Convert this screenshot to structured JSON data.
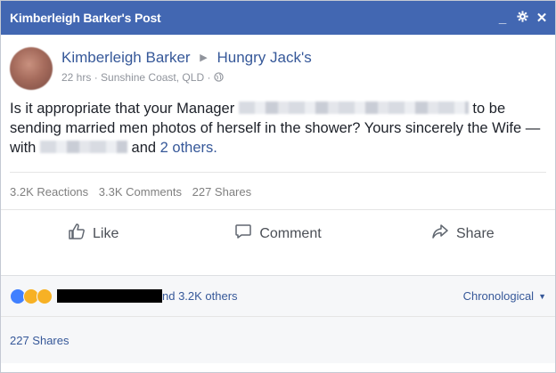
{
  "titlebar": {
    "title": "Kimberleigh Barker's Post"
  },
  "post": {
    "author": "Kimberleigh Barker",
    "target_page": "Hungry Jack's",
    "time": "22 hrs",
    "location": "Sunshine Coast, QLD",
    "text_part1": "Is it appropriate that your Manager",
    "text_part2": "to be sending married men photos of herself in the shower? Yours sincerely the Wife — with",
    "text_part3": "and",
    "tagged_others": "2 others."
  },
  "counts": {
    "reactions": "3.2K Reactions",
    "comments": "3.3K Comments",
    "shares": "227 Shares"
  },
  "actions": {
    "like": "Like",
    "comment": "Comment",
    "share": "Share"
  },
  "footer": {
    "reactions_text": "nd 3.2K others",
    "sort_label": "Chronological",
    "shares_link": "227 Shares"
  }
}
